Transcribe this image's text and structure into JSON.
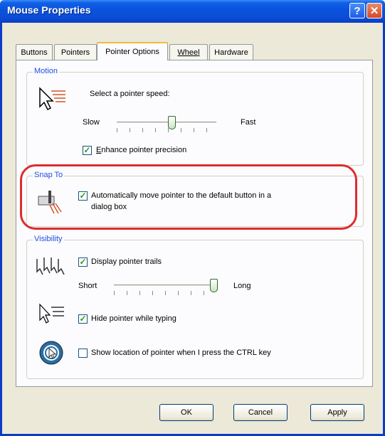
{
  "window": {
    "title": "Mouse Properties"
  },
  "tabs": [
    {
      "label": "Buttons"
    },
    {
      "label": "Pointers"
    },
    {
      "label": "Pointer Options"
    },
    {
      "label": "Wheel"
    },
    {
      "label": "Hardware"
    }
  ],
  "active_tab": "Pointer Options",
  "motion": {
    "label": "Motion",
    "speed_prompt": "Select a pointer speed:",
    "slow_label": "Slow",
    "fast_label": "Fast",
    "speed_level": 0.55,
    "enhance_label": "Enhance pointer precision",
    "enhance_checked": true
  },
  "snap_to": {
    "label": "Snap To",
    "snap_line1": "Automatically move pointer to the default button in a",
    "snap_line2": "dialog box",
    "snap_checked": true
  },
  "visibility": {
    "label": "Visibility",
    "trails_label": "Display pointer trails",
    "trails_checked": true,
    "short_label": "Short",
    "long_label": "Long",
    "trails_level": 1.0,
    "hide_label": "Hide pointer while typing",
    "hide_checked": true,
    "ctrl_label": "Show location of pointer when I press the CTRL key",
    "ctrl_checked": false
  },
  "buttons": {
    "ok": "OK",
    "cancel": "Cancel",
    "apply": "Apply"
  },
  "colors": {
    "titlebar": "#0b4cd4",
    "group_label": "#1f4ee0",
    "highlight": "#dd2d2d",
    "check": "#21a121"
  }
}
